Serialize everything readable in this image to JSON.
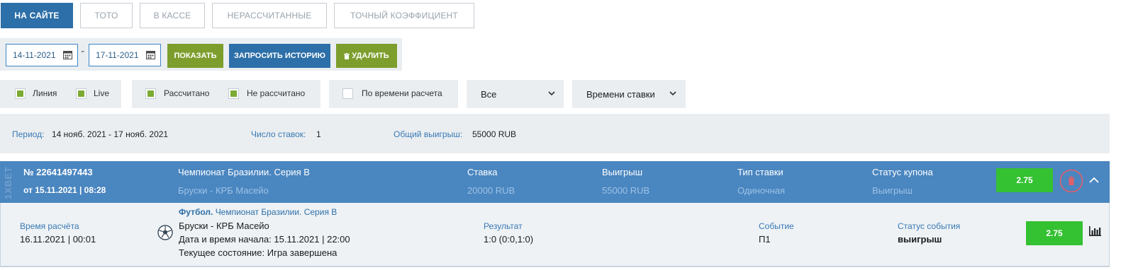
{
  "tabs": [
    {
      "label": "НА САЙТЕ"
    },
    {
      "label": "ТОТО"
    },
    {
      "label": "В КАССЕ"
    },
    {
      "label": "НЕРАССЧИТАННЫЕ"
    },
    {
      "label": "ТОЧНЫЙ КОЭФФИЦИЕНТ"
    }
  ],
  "date_filter": {
    "from": "14-11-2021",
    "to": "17-11-2021",
    "separator": "-",
    "show_label": "ПОКАЗАТЬ",
    "request_history_label": "ЗАПРОСИТЬ ИСТОРИЮ",
    "delete_label": "УДАЛИТЬ"
  },
  "filters": {
    "line_label": "Линия",
    "live_label": "Live",
    "settled_label": "Рассчитано",
    "unsettled_label": "Не рассчитано",
    "by_settle_time_label": "По времени расчета",
    "select_all": "Все",
    "select_sort": "Времени ставки"
  },
  "summary": {
    "period_label": "Период:",
    "period_value": "14 нояб. 2021 - 17 нояб. 2021",
    "bets_count_label": "Число ставок:",
    "bets_count_value": "1",
    "total_win_label": "Общий выигрыш:",
    "total_win_value": "55000 RUB"
  },
  "coupon": {
    "watermark": "1XBET",
    "number": "№ 22641497443",
    "date": "от 15.11.2021 | 08:28",
    "championship": "Чемпионат Бразилии. Серия B",
    "match": "Бруски - КРБ Масейо",
    "stake_label": "Ставка",
    "stake_value": "20000 RUB",
    "win_label": "Выигрыш",
    "win_value": "55000 RUB",
    "bet_type_label": "Тип ставки",
    "bet_type_value": "Одиночная",
    "status_label": "Статус купона",
    "status_value": "Выигрыш",
    "odds": "2.75"
  },
  "details": {
    "settle_time_label": "Время расчёта",
    "settle_time_value": "16.11.2021 | 00:01",
    "sport": "Футбол.",
    "championship": "Чемпионат Бразилии. Серия B",
    "match": "Бруски - КРБ Масейо",
    "start_time": "Дата и время начала: 15.11.2021 | 22:00",
    "state": "Текущее состояние: Игра завершена",
    "result_label": "Результат",
    "result_value": "1:0 (0:0,1:0)",
    "event_label": "Событие",
    "event_value": "П1",
    "event_status_label": "Статус события",
    "event_status_value": "выигрыш",
    "odds": "2.75"
  },
  "colors": {
    "primary_blue": "#2d6fa8",
    "header_blue": "#4a86c0",
    "action_green": "#7d9e2d",
    "odds_green": "#34c132",
    "delete_red": "#e0606a",
    "panel_gray": "#eaeef1"
  }
}
